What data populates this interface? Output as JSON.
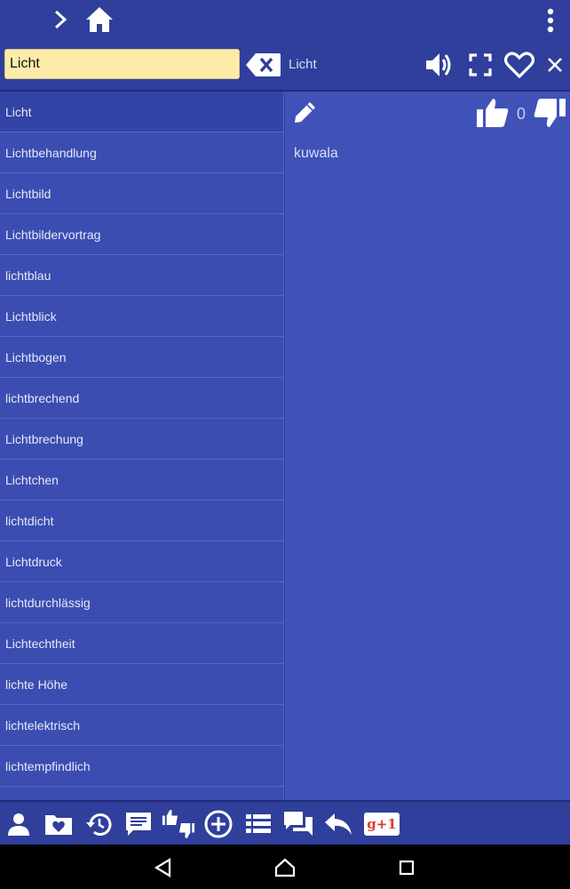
{
  "search": {
    "value": "Licht",
    "current_word": "Licht"
  },
  "word_list": [
    "Licht",
    "Lichtbehandlung",
    "Lichtbild",
    "Lichtbildervortrag",
    "lichtblau",
    "Lichtblick",
    "Lichtbogen",
    "lichtbrechend",
    "Lichtbrechung",
    "Lichtchen",
    "lichtdicht",
    "Lichtdruck",
    "lichtdurchlässig",
    "Lichtechtheit",
    "lichte Höhe",
    "lichtelektrisch",
    "lichtempfindlich"
  ],
  "detail": {
    "vote_count": "0",
    "translation": "kuwala"
  },
  "toolbar": {
    "gplus_label": "g+1"
  },
  "icons": {
    "top": [
      "chevron-right-icon",
      "home-icon",
      "more-vert-icon"
    ],
    "search_row": [
      "backspace-clear-icon",
      "speaker-icon",
      "fullscreen-icon",
      "heart-icon",
      "close-icon"
    ],
    "detail": [
      "pencil-icon",
      "thumb-up-icon",
      "thumb-down-icon"
    ],
    "bottom": [
      "person-icon",
      "favorite-folder-icon",
      "history-icon",
      "comment-icon",
      "thumbs-icon",
      "add-circle-icon",
      "list-icon",
      "forum-icon",
      "reply-icon",
      "google-plus-icon"
    ],
    "nav": [
      "back-icon",
      "home-nav-icon",
      "recents-icon"
    ]
  },
  "colors": {
    "bar": "#2f3f9b",
    "list": "#3b4db1",
    "detail": "#4052b7",
    "search_field": "#fdeca9"
  }
}
